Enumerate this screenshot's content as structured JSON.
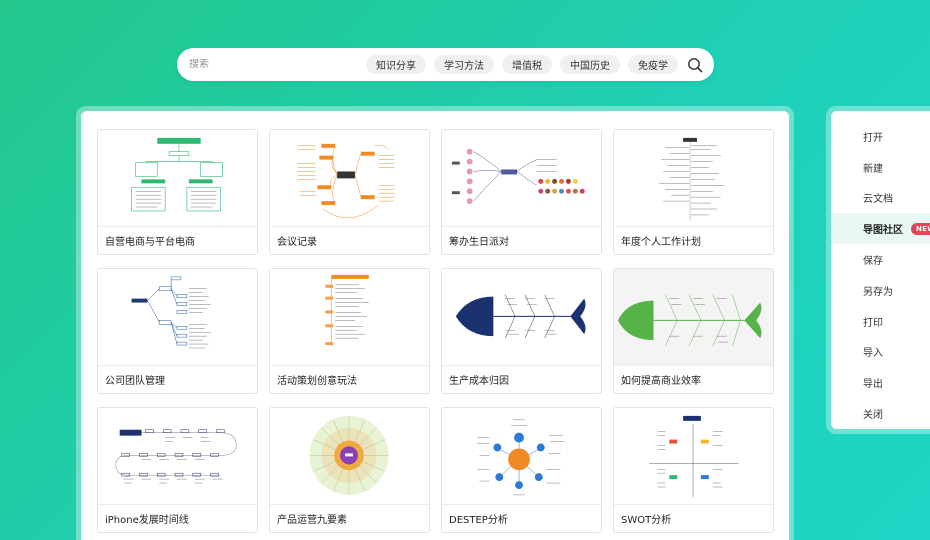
{
  "search": {
    "placeholder": "搜索",
    "tags": [
      "知识分享",
      "学习方法",
      "增值税",
      "中国历史",
      "免疫学"
    ]
  },
  "templates": [
    {
      "title": "自营电商与平台电商"
    },
    {
      "title": "会议记录"
    },
    {
      "title": "筹办生日派对"
    },
    {
      "title": "年度个人工作计划"
    },
    {
      "title": "公司团队管理"
    },
    {
      "title": "活动策划创意玩法"
    },
    {
      "title": "生产成本归因"
    },
    {
      "title": "如何提高商业效率"
    },
    {
      "title": "iPhone发展时间线"
    },
    {
      "title": "产品运营九要素"
    },
    {
      "title": "DESTEP分析"
    },
    {
      "title": "SWOT分析"
    }
  ],
  "menu": {
    "items": [
      "打开",
      "新建",
      "云文档",
      "导图社区",
      "保存",
      "另存为",
      "打印",
      "导入",
      "导出",
      "关闭"
    ],
    "active_index": 3,
    "badge": "NEW"
  },
  "colors": {
    "background_start": "#23c78c",
    "background_end": "#1ed6c6",
    "active_menu_bg": "#e9f8f4",
    "badge": "#f23d5a"
  }
}
